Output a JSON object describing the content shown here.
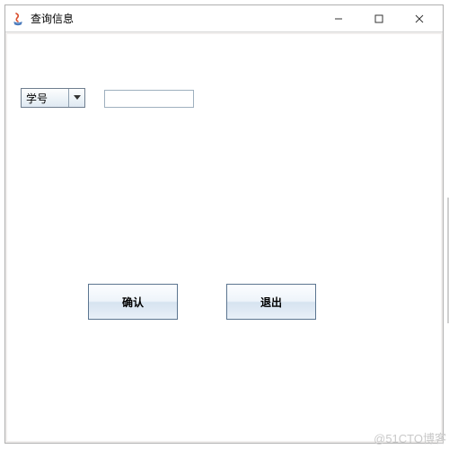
{
  "window": {
    "title": "查询信息"
  },
  "form": {
    "combo_selected": "学号",
    "input_value": ""
  },
  "buttons": {
    "confirm": "确认",
    "exit": "退出"
  },
  "watermark": "@51CTO博客",
  "icons": {
    "app": "java-icon",
    "minimize": "minimize-icon",
    "maximize": "maximize-icon",
    "close": "close-icon",
    "combo_arrow": "chevron-down-icon"
  }
}
